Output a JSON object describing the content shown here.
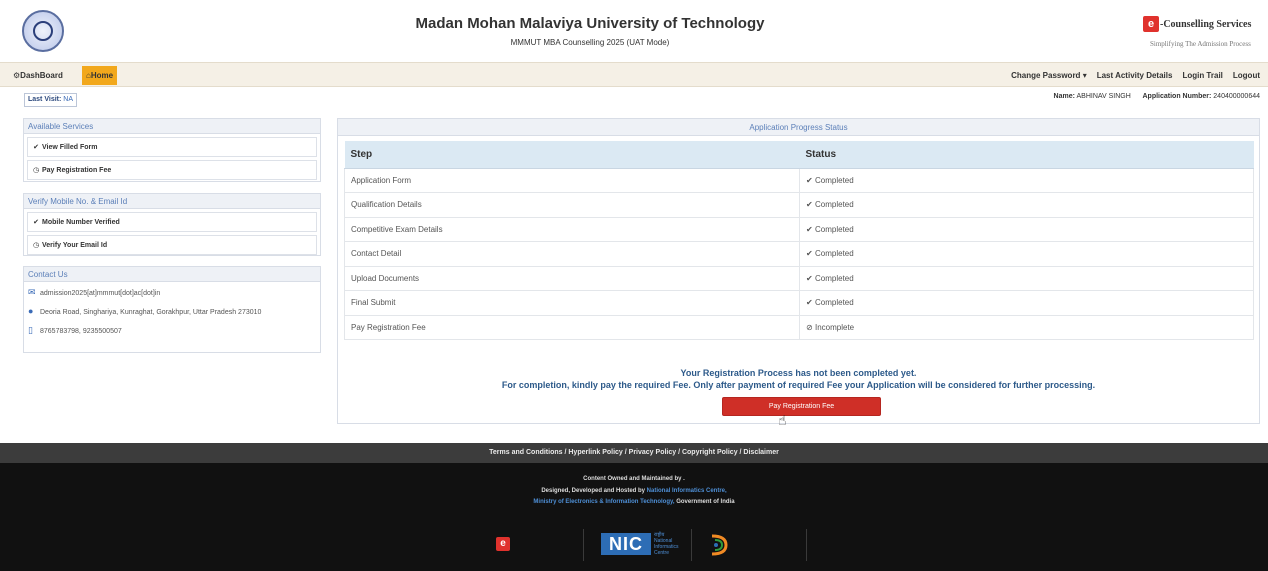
{
  "header": {
    "title": "Madan Mohan Malaviya University of Technology",
    "subtitle": "MMMUT MBA Counselling 2025 (UAT Mode)",
    "brand_name": "-Counselling Services",
    "brand_tagline": "Simplifying The Admission Process"
  },
  "nav": {
    "dashboard": "DashBoard",
    "home": "Home",
    "change_password": "Change Password",
    "last_activity": "Last Activity Details",
    "login_trail": "Login Trail",
    "logout": "Logout"
  },
  "info": {
    "last_visit_label": "Last Visit:",
    "last_visit_value": "NA",
    "name_label": "Name:",
    "name_value": "ABHINAV SINGH",
    "appno_label": "Application Number:",
    "appno_value": "240400000644"
  },
  "services": {
    "title": "Available Services",
    "items": [
      "View Filled Form",
      "Pay Registration Fee"
    ]
  },
  "verify": {
    "title": "Verify Mobile No. & Email Id",
    "items": [
      "Mobile Number Verified",
      "Verify Your Email Id"
    ]
  },
  "contact": {
    "title": "Contact Us",
    "email": "admission2025[at]mmmut[dot]ac[dot]in",
    "address": "Deoria Road, Singhariya, Kunraghat, Gorakhpur, Uttar Pradesh 273010",
    "phone": "8765783798, 9235500507"
  },
  "progress": {
    "title": "Application Progress Status",
    "col_step": "Step",
    "col_status": "Status",
    "rows": [
      {
        "step": "Application Form",
        "status": "Completed"
      },
      {
        "step": "Qualification Details",
        "status": "Completed"
      },
      {
        "step": "Competitive Exam Details",
        "status": "Completed"
      },
      {
        "step": "Contact Detail",
        "status": "Completed"
      },
      {
        "step": "Upload Documents",
        "status": "Completed"
      },
      {
        "step": "Final Submit",
        "status": "Completed"
      },
      {
        "step": "Pay Registration Fee",
        "status": "Incomplete"
      }
    ],
    "message1": "Your Registration Process has not been completed yet.",
    "message2": "For completion, kindly pay the required Fee. Only after payment of required Fee your Application will be considered for further processing.",
    "pay_button": "Pay Registration Fee"
  },
  "footer": {
    "links": "Terms and Conditions  /  Hyperlink Policy  /  Privacy Policy  /  Copyright Policy  /  Disclaimer",
    "line1": "Content Owned and Maintained by .",
    "line2_prefix": "Designed, Developed and Hosted by ",
    "line2_link": "National Informatics Centre,",
    "line3_link": "Ministry of Electronics & Information Technology,",
    "line3_suffix": " Government of India",
    "nic_logo": "NIC",
    "nic_text1": "राष्ट्रीय",
    "nic_text2": "National",
    "nic_text3": "Informatics",
    "nic_text4": "Centre"
  },
  "colors": {
    "home_tab": "#f2a81c",
    "pay_button": "#cf2f27",
    "completed": "#2f9a3c",
    "incomplete": "#d93a2f",
    "table_header": "#dbe9f3"
  }
}
